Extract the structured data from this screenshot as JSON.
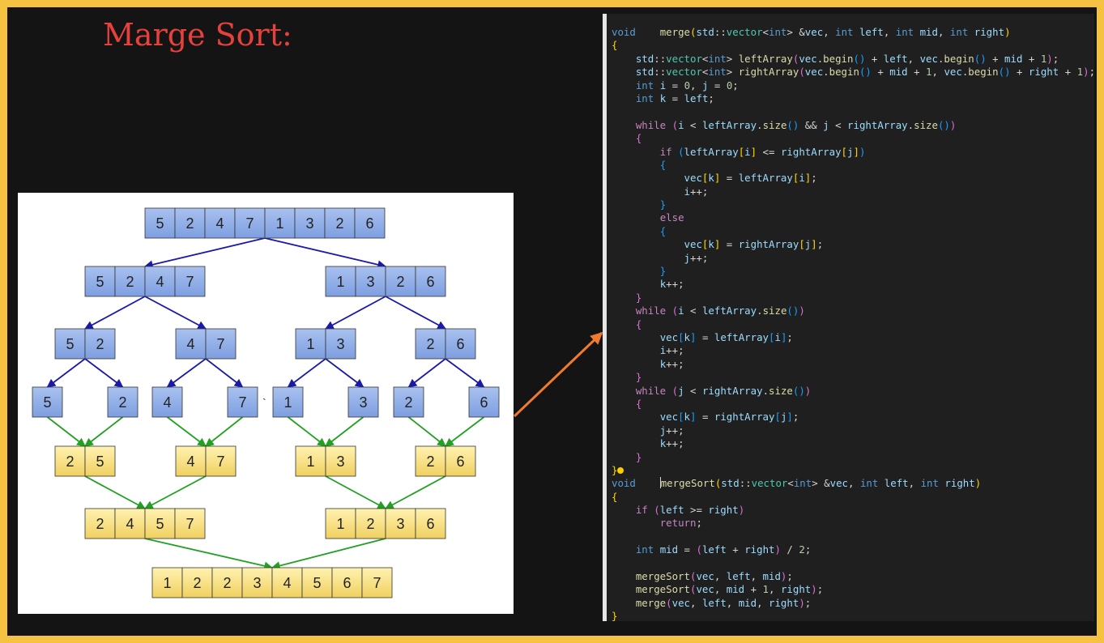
{
  "slide": {
    "title": "Marge Sort:",
    "colors": {
      "frame": "#f5c242",
      "title": "#e8413c",
      "split_arrow": "#1a1aa8",
      "merge_arrow": "#22a022",
      "pointer_arrow": "#f07a30",
      "split_box": "#7d9ee0",
      "merge_box": "#f0d060"
    }
  },
  "diagram": {
    "rows": [
      {
        "kind": "split",
        "groups": [
          [
            5,
            2,
            4,
            7,
            1,
            3,
            2,
            6
          ]
        ]
      },
      {
        "kind": "split",
        "groups": [
          [
            5,
            2,
            4,
            7
          ],
          [
            1,
            3,
            2,
            6
          ]
        ]
      },
      {
        "kind": "split",
        "groups": [
          [
            5,
            2
          ],
          [
            4,
            7
          ],
          [
            1,
            3
          ],
          [
            2,
            6
          ]
        ]
      },
      {
        "kind": "split",
        "groups": [
          [
            5
          ],
          [
            2
          ],
          [
            4
          ],
          [
            7
          ],
          [
            1
          ],
          [
            3
          ],
          [
            2
          ],
          [
            6
          ]
        ]
      },
      {
        "kind": "merge",
        "groups": [
          [
            2,
            5
          ],
          [
            4,
            7
          ],
          [
            1,
            3
          ],
          [
            2,
            6
          ]
        ]
      },
      {
        "kind": "merge",
        "groups": [
          [
            2,
            4,
            5,
            7
          ],
          [
            1,
            2,
            3,
            6
          ]
        ]
      },
      {
        "kind": "merge",
        "groups": [
          [
            1,
            2,
            2,
            3,
            4,
            5,
            6,
            7
          ]
        ]
      }
    ],
    "stray_mark": "`"
  },
  "code": {
    "lines": [
      [
        [
          "kw",
          "void"
        ],
        [
          "op",
          "    "
        ],
        [
          "fn",
          "merge"
        ],
        [
          "p1",
          "("
        ],
        [
          "id",
          "std"
        ],
        [
          "op",
          "::"
        ],
        [
          "type",
          "vector"
        ],
        [
          "op",
          "<"
        ],
        [
          "kw",
          "int"
        ],
        [
          "op",
          "> &"
        ],
        [
          "id",
          "vec"
        ],
        [
          "op",
          ", "
        ],
        [
          "kw",
          "int"
        ],
        [
          "op",
          " "
        ],
        [
          "id",
          "left"
        ],
        [
          "op",
          ", "
        ],
        [
          "kw",
          "int"
        ],
        [
          "op",
          " "
        ],
        [
          "id",
          "mid"
        ],
        [
          "op",
          ", "
        ],
        [
          "kw",
          "int"
        ],
        [
          "op",
          " "
        ],
        [
          "id",
          "right"
        ],
        [
          "p1",
          ")"
        ]
      ],
      [
        [
          "p1",
          "{"
        ]
      ],
      [
        [
          "op",
          "    "
        ],
        [
          "id",
          "std"
        ],
        [
          "op",
          "::"
        ],
        [
          "type",
          "vector"
        ],
        [
          "op",
          "<"
        ],
        [
          "kw",
          "int"
        ],
        [
          "op",
          "> "
        ],
        [
          "fn",
          "leftArray"
        ],
        [
          "p2",
          "("
        ],
        [
          "id",
          "vec"
        ],
        [
          "op",
          "."
        ],
        [
          "fn",
          "begin"
        ],
        [
          "p3",
          "()"
        ],
        [
          "op",
          " + "
        ],
        [
          "id",
          "left"
        ],
        [
          "op",
          ", "
        ],
        [
          "id",
          "vec"
        ],
        [
          "op",
          "."
        ],
        [
          "fn",
          "begin"
        ],
        [
          "p3",
          "()"
        ],
        [
          "op",
          " + "
        ],
        [
          "id",
          "mid"
        ],
        [
          "op",
          " + "
        ],
        [
          "num",
          "1"
        ],
        [
          "p2",
          ")"
        ],
        [
          "op",
          ";"
        ]
      ],
      [
        [
          "op",
          "    "
        ],
        [
          "id",
          "std"
        ],
        [
          "op",
          "::"
        ],
        [
          "type",
          "vector"
        ],
        [
          "op",
          "<"
        ],
        [
          "kw",
          "int"
        ],
        [
          "op",
          "> "
        ],
        [
          "fn",
          "rightArray"
        ],
        [
          "p2",
          "("
        ],
        [
          "id",
          "vec"
        ],
        [
          "op",
          "."
        ],
        [
          "fn",
          "begin"
        ],
        [
          "p3",
          "()"
        ],
        [
          "op",
          " + "
        ],
        [
          "id",
          "mid"
        ],
        [
          "op",
          " + "
        ],
        [
          "num",
          "1"
        ],
        [
          "op",
          ", "
        ],
        [
          "id",
          "vec"
        ],
        [
          "op",
          "."
        ],
        [
          "fn",
          "begin"
        ],
        [
          "p3",
          "()"
        ],
        [
          "op",
          " + "
        ],
        [
          "id",
          "right"
        ],
        [
          "op",
          " + "
        ],
        [
          "num",
          "1"
        ],
        [
          "p2",
          ")"
        ],
        [
          "op",
          ";"
        ]
      ],
      [
        [
          "op",
          "    "
        ],
        [
          "kw",
          "int"
        ],
        [
          "op",
          " "
        ],
        [
          "id",
          "i"
        ],
        [
          "op",
          " = "
        ],
        [
          "num",
          "0"
        ],
        [
          "op",
          ", "
        ],
        [
          "id",
          "j"
        ],
        [
          "op",
          " = "
        ],
        [
          "num",
          "0"
        ],
        [
          "op",
          ";"
        ]
      ],
      [
        [
          "op",
          "    "
        ],
        [
          "kw",
          "int"
        ],
        [
          "op",
          " "
        ],
        [
          "id",
          "k"
        ],
        [
          "op",
          " = "
        ],
        [
          "id",
          "left"
        ],
        [
          "op",
          ";"
        ]
      ],
      [],
      [
        [
          "op",
          "    "
        ],
        [
          "ctl",
          "while"
        ],
        [
          "op",
          " "
        ],
        [
          "p2",
          "("
        ],
        [
          "id",
          "i"
        ],
        [
          "op",
          " < "
        ],
        [
          "id",
          "leftArray"
        ],
        [
          "op",
          "."
        ],
        [
          "fn",
          "size"
        ],
        [
          "p3",
          "()"
        ],
        [
          "op",
          " && "
        ],
        [
          "id",
          "j"
        ],
        [
          "op",
          " < "
        ],
        [
          "id",
          "rightArray"
        ],
        [
          "op",
          "."
        ],
        [
          "fn",
          "size"
        ],
        [
          "p3",
          "()"
        ],
        [
          "p2",
          ")"
        ]
      ],
      [
        [
          "op",
          "    "
        ],
        [
          "p2",
          "{"
        ]
      ],
      [
        [
          "op",
          "        "
        ],
        [
          "ctl",
          "if"
        ],
        [
          "op",
          " "
        ],
        [
          "p3",
          "("
        ],
        [
          "id",
          "leftArray"
        ],
        [
          "p1",
          "["
        ],
        [
          "id",
          "i"
        ],
        [
          "p1",
          "]"
        ],
        [
          "op",
          " <= "
        ],
        [
          "id",
          "rightArray"
        ],
        [
          "p1",
          "["
        ],
        [
          "id",
          "j"
        ],
        [
          "p1",
          "]"
        ],
        [
          "p3",
          ")"
        ]
      ],
      [
        [
          "op",
          "        "
        ],
        [
          "p3",
          "{"
        ]
      ],
      [
        [
          "op",
          "            "
        ],
        [
          "id",
          "vec"
        ],
        [
          "p1",
          "["
        ],
        [
          "id",
          "k"
        ],
        [
          "p1",
          "]"
        ],
        [
          "op",
          " = "
        ],
        [
          "id",
          "leftArray"
        ],
        [
          "p1",
          "["
        ],
        [
          "id",
          "i"
        ],
        [
          "p1",
          "]"
        ],
        [
          "op",
          ";"
        ]
      ],
      [
        [
          "op",
          "            "
        ],
        [
          "id",
          "i"
        ],
        [
          "op",
          "++;"
        ]
      ],
      [
        [
          "op",
          "        "
        ],
        [
          "p3",
          "}"
        ]
      ],
      [
        [
          "op",
          "        "
        ],
        [
          "ctl",
          "else"
        ]
      ],
      [
        [
          "op",
          "        "
        ],
        [
          "p3",
          "{"
        ]
      ],
      [
        [
          "op",
          "            "
        ],
        [
          "id",
          "vec"
        ],
        [
          "p1",
          "["
        ],
        [
          "id",
          "k"
        ],
        [
          "p1",
          "]"
        ],
        [
          "op",
          " = "
        ],
        [
          "id",
          "rightArray"
        ],
        [
          "p1",
          "["
        ],
        [
          "id",
          "j"
        ],
        [
          "p1",
          "]"
        ],
        [
          "op",
          ";"
        ]
      ],
      [
        [
          "op",
          "            "
        ],
        [
          "id",
          "j"
        ],
        [
          "op",
          "++;"
        ]
      ],
      [
        [
          "op",
          "        "
        ],
        [
          "p3",
          "}"
        ]
      ],
      [
        [
          "op",
          "        "
        ],
        [
          "id",
          "k"
        ],
        [
          "op",
          "++;"
        ]
      ],
      [
        [
          "op",
          "    "
        ],
        [
          "p2",
          "}"
        ]
      ],
      [
        [
          "op",
          "    "
        ],
        [
          "ctl",
          "while"
        ],
        [
          "op",
          " "
        ],
        [
          "p2",
          "("
        ],
        [
          "id",
          "i"
        ],
        [
          "op",
          " < "
        ],
        [
          "id",
          "leftArray"
        ],
        [
          "op",
          "."
        ],
        [
          "fn",
          "size"
        ],
        [
          "p3",
          "()"
        ],
        [
          "p2",
          ")"
        ]
      ],
      [
        [
          "op",
          "    "
        ],
        [
          "p2",
          "{"
        ]
      ],
      [
        [
          "op",
          "        "
        ],
        [
          "id",
          "vec"
        ],
        [
          "p3",
          "["
        ],
        [
          "id",
          "k"
        ],
        [
          "p3",
          "]"
        ],
        [
          "op",
          " = "
        ],
        [
          "id",
          "leftArray"
        ],
        [
          "p3",
          "["
        ],
        [
          "id",
          "i"
        ],
        [
          "p3",
          "]"
        ],
        [
          "op",
          ";"
        ]
      ],
      [
        [
          "op",
          "        "
        ],
        [
          "id",
          "i"
        ],
        [
          "op",
          "++;"
        ]
      ],
      [
        [
          "op",
          "        "
        ],
        [
          "id",
          "k"
        ],
        [
          "op",
          "++;"
        ]
      ],
      [
        [
          "op",
          "    "
        ],
        [
          "p2",
          "}"
        ]
      ],
      [
        [
          "op",
          "    "
        ],
        [
          "ctl",
          "while"
        ],
        [
          "op",
          " "
        ],
        [
          "p2",
          "("
        ],
        [
          "id",
          "j"
        ],
        [
          "op",
          " < "
        ],
        [
          "id",
          "rightArray"
        ],
        [
          "op",
          "."
        ],
        [
          "fn",
          "size"
        ],
        [
          "p3",
          "()"
        ],
        [
          "p2",
          ")"
        ]
      ],
      [
        [
          "op",
          "    "
        ],
        [
          "p2",
          "{"
        ]
      ],
      [
        [
          "op",
          "        "
        ],
        [
          "id",
          "vec"
        ],
        [
          "p3",
          "["
        ],
        [
          "id",
          "k"
        ],
        [
          "p3",
          "]"
        ],
        [
          "op",
          " = "
        ],
        [
          "id",
          "rightArray"
        ],
        [
          "p3",
          "["
        ],
        [
          "id",
          "j"
        ],
        [
          "p3",
          "]"
        ],
        [
          "op",
          ";"
        ]
      ],
      [
        [
          "op",
          "        "
        ],
        [
          "id",
          "j"
        ],
        [
          "op",
          "++;"
        ]
      ],
      [
        [
          "op",
          "        "
        ],
        [
          "id",
          "k"
        ],
        [
          "op",
          "++;"
        ]
      ],
      [
        [
          "op",
          "    "
        ],
        [
          "p2",
          "}"
        ]
      ],
      [
        [
          "p1",
          "}"
        ],
        [
          "bulb",
          ""
        ]
      ],
      [
        [
          "kw",
          "void"
        ],
        [
          "op",
          "    "
        ],
        [
          "caret",
          ""
        ],
        [
          "fn",
          "mergeSort"
        ],
        [
          "p1",
          "("
        ],
        [
          "id",
          "std"
        ],
        [
          "op",
          "::"
        ],
        [
          "type",
          "vector"
        ],
        [
          "op",
          "<"
        ],
        [
          "kw",
          "int"
        ],
        [
          "op",
          "> &"
        ],
        [
          "id",
          "vec"
        ],
        [
          "op",
          ", "
        ],
        [
          "kw",
          "int"
        ],
        [
          "op",
          " "
        ],
        [
          "id",
          "left"
        ],
        [
          "op",
          ", "
        ],
        [
          "kw",
          "int"
        ],
        [
          "op",
          " "
        ],
        [
          "id",
          "right"
        ],
        [
          "p1",
          ")"
        ]
      ],
      [
        [
          "p1",
          "{"
        ]
      ],
      [
        [
          "op",
          "    "
        ],
        [
          "ctl",
          "if"
        ],
        [
          "op",
          " "
        ],
        [
          "p2",
          "("
        ],
        [
          "id",
          "left"
        ],
        [
          "op",
          " >= "
        ],
        [
          "id",
          "right"
        ],
        [
          "p2",
          ")"
        ]
      ],
      [
        [
          "op",
          "        "
        ],
        [
          "ctl",
          "return"
        ],
        [
          "op",
          ";"
        ]
      ],
      [],
      [
        [
          "op",
          "    "
        ],
        [
          "kw",
          "int"
        ],
        [
          "op",
          " "
        ],
        [
          "id",
          "mid"
        ],
        [
          "op",
          " = "
        ],
        [
          "p2",
          "("
        ],
        [
          "id",
          "left"
        ],
        [
          "op",
          " + "
        ],
        [
          "id",
          "right"
        ],
        [
          "p2",
          ")"
        ],
        [
          "op",
          " / "
        ],
        [
          "num",
          "2"
        ],
        [
          "op",
          ";"
        ]
      ],
      [],
      [
        [
          "op",
          "    "
        ],
        [
          "fn",
          "mergeSort"
        ],
        [
          "p2",
          "("
        ],
        [
          "id",
          "vec"
        ],
        [
          "op",
          ", "
        ],
        [
          "id",
          "left"
        ],
        [
          "op",
          ", "
        ],
        [
          "id",
          "mid"
        ],
        [
          "p2",
          ")"
        ],
        [
          "op",
          ";"
        ]
      ],
      [
        [
          "op",
          "    "
        ],
        [
          "fn",
          "mergeSort"
        ],
        [
          "p2",
          "("
        ],
        [
          "id",
          "vec"
        ],
        [
          "op",
          ", "
        ],
        [
          "id",
          "mid"
        ],
        [
          "op",
          " + "
        ],
        [
          "num",
          "1"
        ],
        [
          "op",
          ", "
        ],
        [
          "id",
          "right"
        ],
        [
          "p2",
          ")"
        ],
        [
          "op",
          ";"
        ]
      ],
      [
        [
          "op",
          "    "
        ],
        [
          "fn",
          "merge"
        ],
        [
          "p2",
          "("
        ],
        [
          "id",
          "vec"
        ],
        [
          "op",
          ", "
        ],
        [
          "id",
          "left"
        ],
        [
          "op",
          ", "
        ],
        [
          "id",
          "mid"
        ],
        [
          "op",
          ", "
        ],
        [
          "id",
          "right"
        ],
        [
          "p2",
          ")"
        ],
        [
          "op",
          ";"
        ]
      ],
      [
        [
          "p1",
          "}"
        ]
      ]
    ]
  }
}
